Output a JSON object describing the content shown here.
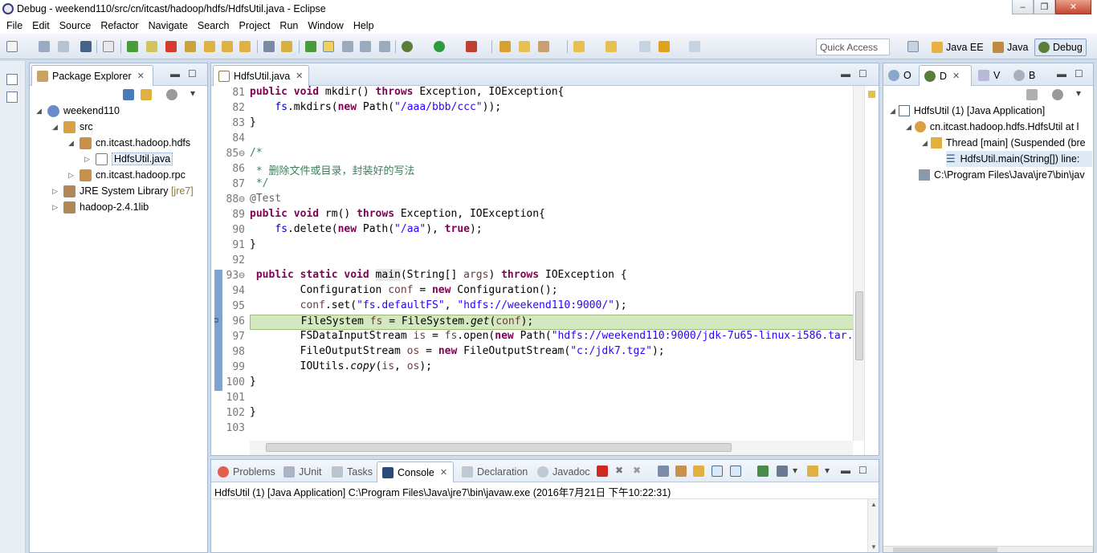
{
  "window": {
    "title": "Debug - weekend110/src/cn/itcast/hadoop/hdfs/HdfsUtil.java - Eclipse",
    "minimize": "–",
    "maximize": "❐",
    "close": "✕"
  },
  "menu": [
    "File",
    "Edit",
    "Source",
    "Refactor",
    "Navigate",
    "Search",
    "Project",
    "Run",
    "Window",
    "Help"
  ],
  "toolbar": {
    "quick_access_placeholder": "Quick Access",
    "perspectives": [
      "Java EE",
      "Java",
      "Debug"
    ]
  },
  "package_explorer": {
    "title": "Package Explorer",
    "items": [
      {
        "label": "weekend110",
        "arrow": "◢"
      },
      {
        "label": "src",
        "arrow": "◢"
      },
      {
        "label": "cn.itcast.hadoop.hdfs",
        "arrow": "◢"
      },
      {
        "label": "HdfsUtil.java",
        "arrow": "▷"
      },
      {
        "label": "cn.itcast.hadoop.rpc",
        "arrow": "▷"
      },
      {
        "label": "JRE System Library",
        "suffix": "[jre7]",
        "arrow": "▷"
      },
      {
        "label": "hadoop-2.4.1lib",
        "arrow": "▷"
      }
    ]
  },
  "editor": {
    "tab": "HdfsUtil.java",
    "line_numbers": [
      "81",
      "82",
      "83",
      "84",
      "85⊖",
      "86",
      "87",
      "88⊖",
      "89",
      "90",
      "91",
      "92",
      "93⊖",
      "94",
      "95",
      "96",
      "97",
      "98",
      "99",
      "100",
      "101",
      "102",
      "103"
    ],
    "current_line": "96"
  },
  "debug_view": {
    "tabs": [
      "O",
      "D",
      "V",
      "B"
    ],
    "items": [
      "HdfsUtil (1) [Java Application]",
      "cn.itcast.hadoop.hdfs.HdfsUtil at l",
      "Thread [main] (Suspended (bre",
      "HdfsUtil.main(String[]) line:",
      "C:\\Program Files\\Java\\jre7\\bin\\jav"
    ]
  },
  "bottom": {
    "tabs": [
      "Problems",
      "JUnit",
      "Tasks",
      "Console",
      "Declaration",
      "Javadoc"
    ],
    "console_line": "HdfsUtil (1) [Java Application] C:\\Program Files\\Java\\jre7\\bin\\javaw.exe (2016年7月21日 下午10:22:31)"
  },
  "colors": {
    "keyword": "#7f0055",
    "string": "#2a00ff",
    "comment": "#3f7f5f",
    "current_line": "#d4e8c0",
    "field": "#0000c0"
  }
}
